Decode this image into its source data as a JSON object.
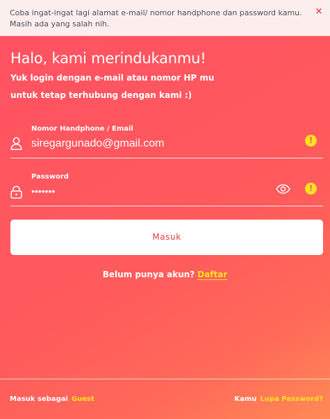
{
  "alert": {
    "message": "Coba ingat-ingat lagi alamat e-mail/ nomor handphone dan password kamu. Masih ada yang salah nih.",
    "close_icon": "×"
  },
  "header": {
    "title": "Halo, kami merindukanmu!",
    "subtitle": "Yuk login dengan e-mail atau nomor HP mu untuk tetap terhubung dengan kami :)"
  },
  "form": {
    "identity_label": "Nomor Handphone / Email",
    "identity_value": "siregargunado@gmail.com",
    "password_label": "Password",
    "password_value": "•••••••",
    "warning_mark": "!",
    "submit_label": "Masuk"
  },
  "signup": {
    "prompt": "Belum punya akun?",
    "link": "Daftar"
  },
  "footer": {
    "guest_prefix": "Masuk sebagai",
    "guest_link": "Guest",
    "forgot_prefix": "Kamu",
    "forgot_link": "Lupa Password?"
  },
  "colors": {
    "accent": "#ff5a5c",
    "link": "#ffe21f",
    "alert_bg": "#fdeeee",
    "button_text": "#e03c44"
  },
  "icons": [
    "close-icon",
    "user-icon",
    "warning-icon",
    "lock-icon",
    "eye-icon"
  ]
}
